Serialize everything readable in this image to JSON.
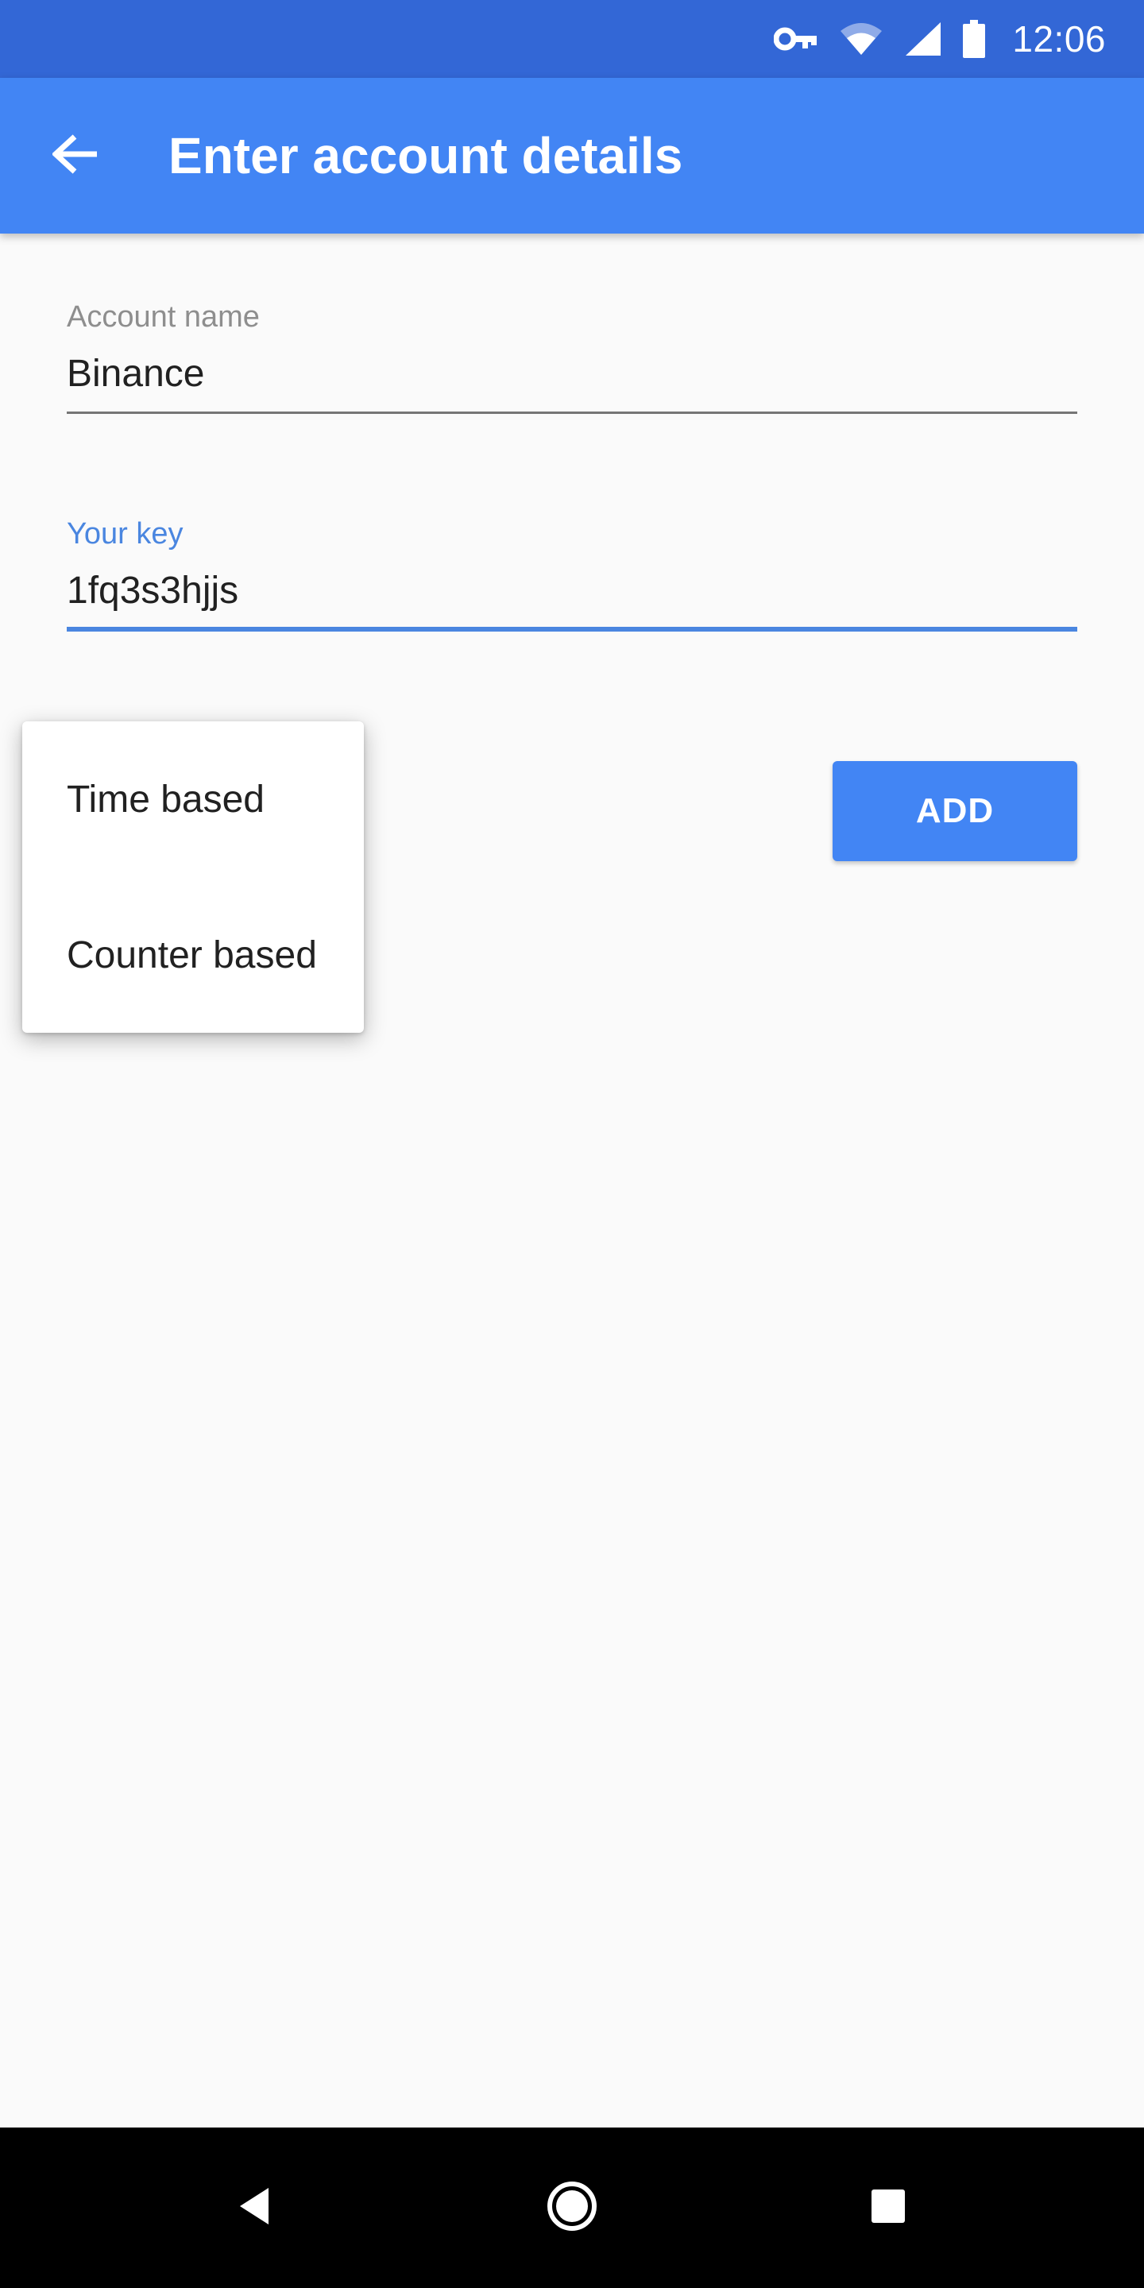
{
  "status_bar": {
    "time": "12:06",
    "icons": [
      "vpn-key-icon",
      "wifi-icon",
      "cell-signal-icon",
      "battery-icon"
    ],
    "background": "#3367d6"
  },
  "app_bar": {
    "title": "Enter account details",
    "back_icon": "arrow-back-icon",
    "background": "#4285f4"
  },
  "form": {
    "account_name": {
      "label": "Account name",
      "value": "Binance"
    },
    "key": {
      "label": "Your key",
      "value": "1fq3s3hjjs"
    }
  },
  "type_menu": {
    "options": [
      "Time based",
      "Counter based"
    ]
  },
  "actions": {
    "add_label": "ADD",
    "accent": "#4285f4"
  },
  "nav_bar": {
    "icons": [
      "nav-back-icon",
      "nav-home-icon",
      "nav-recents-icon"
    ]
  }
}
